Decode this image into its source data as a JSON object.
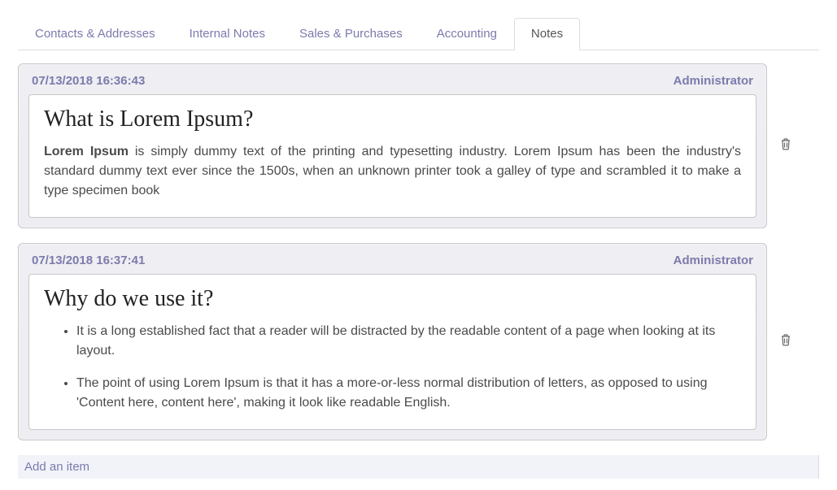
{
  "tabs": [
    {
      "label": "Contacts & Addresses",
      "active": false
    },
    {
      "label": "Internal Notes",
      "active": false
    },
    {
      "label": "Sales & Purchases",
      "active": false
    },
    {
      "label": "Accounting",
      "active": false
    },
    {
      "label": "Notes",
      "active": true
    }
  ],
  "notes": [
    {
      "timestamp": "07/13/2018 16:36:43",
      "author": "Administrator",
      "title": "What is Lorem Ipsum?",
      "bold_lead": "Lorem Ipsum",
      "body_rest": " is simply dummy text of the printing and typesetting industry. Lorem Ipsum has been the industry's standard dummy text ever since the 1500s, when an unknown printer took a galley of type and scrambled it to make a type specimen book"
    },
    {
      "timestamp": "07/13/2018 16:37:41",
      "author": "Administrator",
      "title": "Why do we use it?",
      "bullets": [
        "It is a long established fact that a reader will be distracted by the readable content of a page when looking at its layout.",
        "The point of using Lorem Ipsum is that it has a more-or-less normal distribution of letters, as opposed to using 'Content here, content here', making it look like readable English."
      ]
    }
  ],
  "add_item_label": "Add an item"
}
